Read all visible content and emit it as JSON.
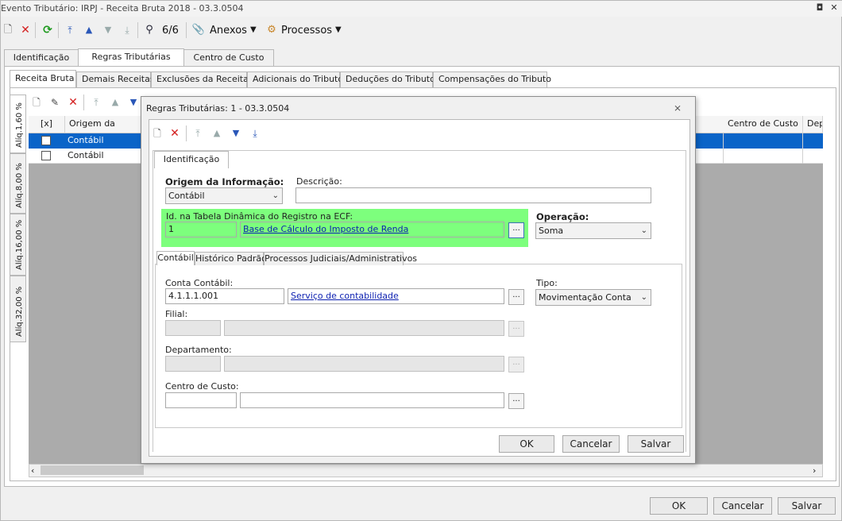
{
  "window": {
    "title": "Evento Tributário: IRPJ - Receita Bruta 2018 - 03.3.0504"
  },
  "toolbar": {
    "counter": "6/6",
    "anexos": "Anexos",
    "processos": "Processos"
  },
  "main_tabs": [
    {
      "label": "Identificação"
    },
    {
      "label": "Regras Tributárias"
    },
    {
      "label": "Centro de Custo"
    }
  ],
  "sub_tabs": [
    {
      "label": "Receita Bruta"
    },
    {
      "label": "Demais Receitas"
    },
    {
      "label": "Exclusões da Receita"
    },
    {
      "label": "Adicionais do Tributo"
    },
    {
      "label": "Deduções do Tributo"
    },
    {
      "label": "Compensações do Tributo"
    }
  ],
  "side_tabs": [
    {
      "label": "Alíq.1,60 %"
    },
    {
      "label": "Alíq.8,00 %"
    },
    {
      "label": "Alíq.16,00 %"
    },
    {
      "label": "Alíq.32,00 %"
    }
  ],
  "grid": {
    "headers": {
      "check": "[x]",
      "origem": "Origem da",
      "centro": "Centro de Custo",
      "dep": "Dep"
    },
    "rows": [
      {
        "origem": "Contábil"
      },
      {
        "origem": "Contábil"
      }
    ]
  },
  "dialog": {
    "title": "Regras Tributárias: 1 - 03.3.0504",
    "tab": "Identificação",
    "origem_label": "Origem da Informação:",
    "origem_value": "Contábil",
    "descricao_label": "Descrição:",
    "descricao_value": "",
    "id_label": "Id. na Tabela Dinâmica do Registro na ECF:",
    "id_value": "1",
    "id_desc": "Base de Cálculo do Imposto de Renda",
    "operacao_label": "Operação:",
    "operacao_value": "Soma",
    "inner_tabs": [
      {
        "label": "Contábil"
      },
      {
        "label": "Histórico Padrão"
      },
      {
        "label": "Processos Judiciais/Administrativos"
      }
    ],
    "conta_label": "Conta Contábil:",
    "conta_code": "4.1.1.1.001",
    "conta_desc": "Serviço de contabilidade",
    "tipo_label": "Tipo:",
    "tipo_value": "Movimentação Conta",
    "filial_label": "Filial:",
    "depto_label": "Departamento:",
    "centro_label": "Centro de Custo:",
    "ellipsis": "...",
    "ok": "OK",
    "cancel": "Cancelar",
    "save": "Salvar"
  },
  "footer": {
    "ok": "OK",
    "cancel": "Cancelar",
    "save": "Salvar"
  },
  "colors": {
    "selection": "#0a64c8",
    "highlight": "#7dff7d",
    "link": "#0b1fb0"
  }
}
